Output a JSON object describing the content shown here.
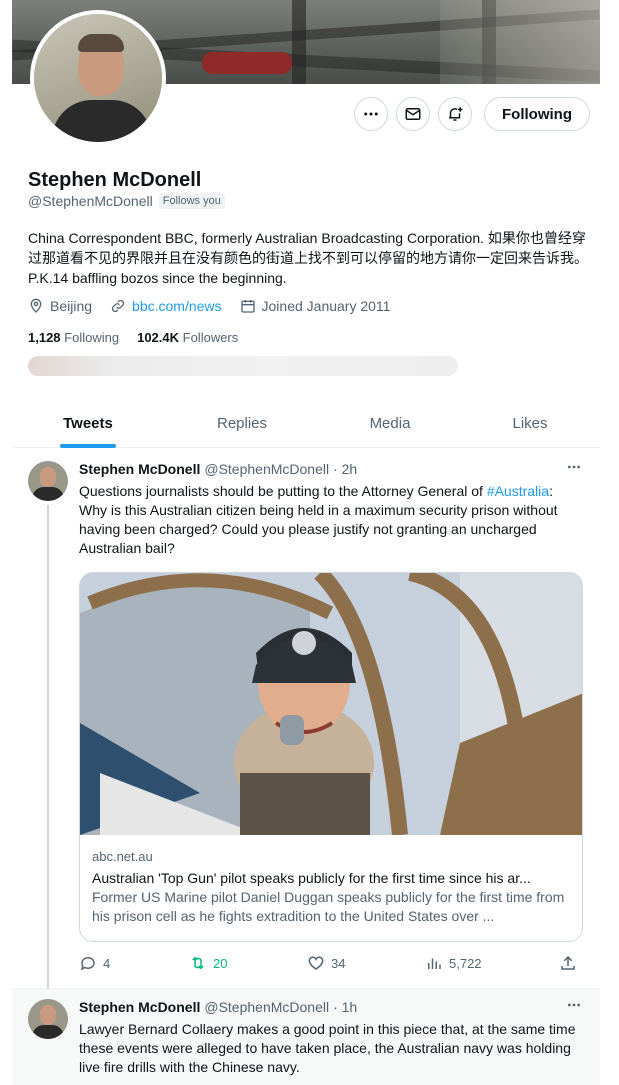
{
  "profile": {
    "name": "Stephen McDonell",
    "handle": "@StephenMcDonell",
    "follows_you": "Follows you",
    "bio": "China Correspondent BBC, formerly Australian Broadcasting Corporation. 如果你也曾经穿过那道看不见的界限并且在没有颜色的街道上找不到可以停留的地方请你一定回来告诉我。P.K.14 baffling bozos since the beginning.",
    "location": "Beijing",
    "website": "bbc.com/news",
    "joined": "Joined January 2011",
    "following_count": "1,128",
    "following_label": "Following",
    "followers_count": "102.4K",
    "followers_label": "Followers",
    "follow_button": "Following"
  },
  "tabs": [
    {
      "label": "Tweets",
      "active": true
    },
    {
      "label": "Replies",
      "active": false
    },
    {
      "label": "Media",
      "active": false
    },
    {
      "label": "Likes",
      "active": false
    }
  ],
  "tweets": [
    {
      "name": "Stephen McDonell",
      "handle": "@StephenMcDonell",
      "time": "· 2h",
      "text_before": "Questions journalists should be putting to the Attorney General of ",
      "hashtag": "#Australia",
      "text_after": ": Why is this Australian citizen being held in a maximum security prison without having been charged? Could you please justify not granting an uncharged Australian bail?",
      "card": {
        "domain": "abc.net.au",
        "title": "Australian 'Top Gun' pilot speaks publicly for the first time since his ar...",
        "description": "Former US Marine pilot Daniel Duggan speaks publicly for the first time from his prison cell as he fights extradition to the United States over ..."
      },
      "stats": {
        "replies": "4",
        "retweets": "20",
        "likes": "34",
        "views": "5,722"
      }
    },
    {
      "name": "Stephen McDonell",
      "handle": "@StephenMcDonell",
      "time": "· 1h",
      "text": "Lawyer Bernard Collaery makes a good point in this piece that, at the same time these events were alleged to have taken place, the Australian navy was holding live fire drills with the Chinese navy."
    }
  ],
  "icons": {
    "more": "more-icon",
    "mail": "mail-icon",
    "notify": "bell-plus-icon",
    "location": "location-pin-icon",
    "link": "link-icon",
    "calendar": "calendar-icon",
    "reply": "reply-icon",
    "retweet": "retweet-icon",
    "like": "heart-icon",
    "views": "views-icon",
    "share": "share-icon"
  },
  "colors": {
    "accent": "#1d9bf0",
    "retweet": "#00ba7c",
    "muted": "#536471",
    "text": "#0f1419"
  }
}
